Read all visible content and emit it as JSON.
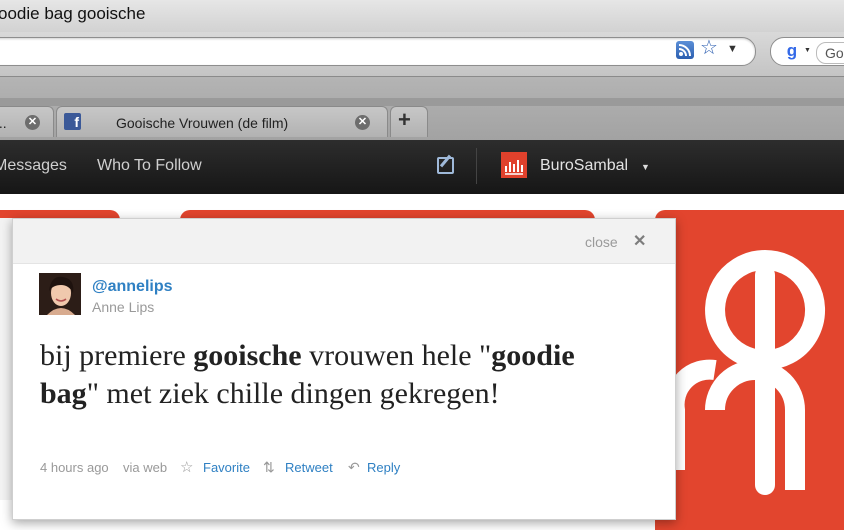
{
  "window": {
    "title": "oodie bag gooische"
  },
  "toolbar": {
    "search_placeholder": "Go"
  },
  "tabs": [
    {
      "title": "..."
    },
    {
      "title": "Gooische Vrouwen (de film)"
    }
  ],
  "twitter_nav": {
    "items": [
      "Messages",
      "Who To Follow"
    ],
    "account_name": "BuroSambal"
  },
  "popup": {
    "close_label": "close"
  },
  "tweet": {
    "handle": "@annelips",
    "name": "Anne Lips",
    "text_parts": [
      {
        "text": "bij premiere ",
        "bold": false
      },
      {
        "text": "gooische",
        "bold": true
      },
      {
        "text": " vrouwen hele \"",
        "bold": false
      },
      {
        "text": "goodie bag",
        "bold": true
      },
      {
        "text": "\" met ziek chille dingen gekregen!",
        "bold": false
      }
    ],
    "time": "4 hours ago",
    "source": "via web",
    "actions": {
      "favorite": "Favorite",
      "retweet": "Retweet",
      "reply": "Reply"
    }
  },
  "colors": {
    "accent_red": "#e2452e",
    "link_blue": "#2f80c3",
    "topbar": "#1f1f1f"
  },
  "icons": [
    "rss-icon",
    "bookmark-star-icon",
    "google-search-icon",
    "facebook-favicon",
    "compose-icon",
    "close-icon",
    "favorite-star-icon",
    "retweet-icon",
    "reply-icon"
  ]
}
